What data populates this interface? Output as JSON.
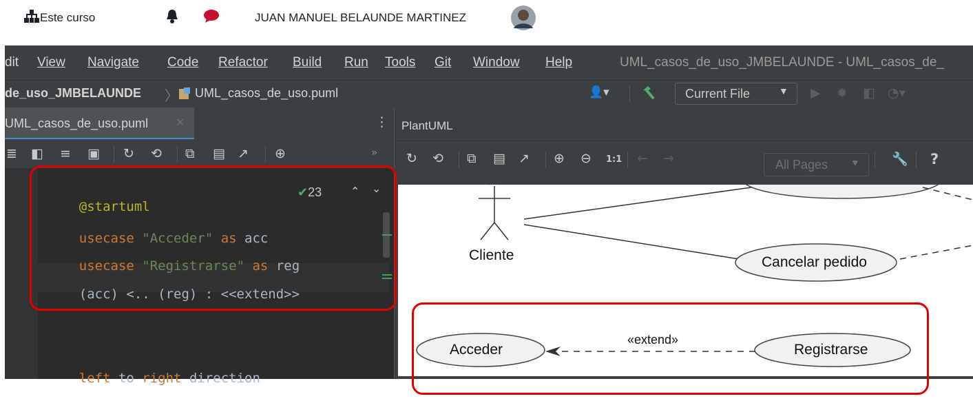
{
  "topbar": {
    "course_label": "Este curso",
    "user_name": "JUAN MANUEL BELAUNDE MARTINEZ"
  },
  "menubar": {
    "items": [
      "dit",
      "View",
      "Navigate",
      "Code",
      "Refactor",
      "Build",
      "Run",
      "Tools",
      "Git",
      "Window",
      "Help"
    ],
    "title": "UML_casos_de_uso_JMBELAUNDE - UML_casos_de_"
  },
  "navbar": {
    "project": "de_uso_JMBELAUNDE",
    "file": "UML_casos_de_uso.puml",
    "run_config": "Current File"
  },
  "editor": {
    "tab_label": "UML_casos_de_uso.puml",
    "inspection_count": "23",
    "lines": {
      "l1": "@startuml",
      "l2_kw": "usecase",
      "l2_str": "\"Acceder\"",
      "l2_as": "as",
      "l2_id": "acc",
      "l3_kw": "usecase",
      "l3_str": "\"Registrarse\"",
      "l3_as": "as",
      "l3_id": "reg",
      "l4": "(acc) <.. (reg) : <<extend>>",
      "l5_kw1": "left",
      "l5_mid1": " to ",
      "l5_kw2": "right",
      "l5_mid2": " direction"
    }
  },
  "plantuml": {
    "tab_label": "PlantUML",
    "zoom_reset": "1:1",
    "pages_select": "All Pages",
    "help": "?",
    "diagram": {
      "actor": "Cliente",
      "usecase_cancel": "Cancelar pedido",
      "usecase_acceder": "Acceder",
      "usecase_registrarse": "Registrarse",
      "extend_label": "«extend»"
    }
  },
  "colors": {
    "highlight": "#e00000",
    "ide_bg": "#3c3f41",
    "editor_bg": "#2b2b2b"
  }
}
